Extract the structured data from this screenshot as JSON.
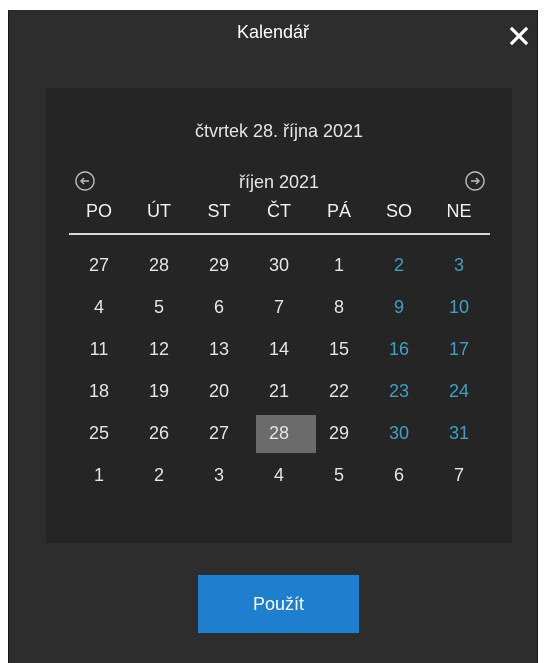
{
  "window": {
    "title": "Kalendář"
  },
  "calendar": {
    "selected_long_date": "čtvrtek 28. října 2021",
    "month_label": "říjen 2021",
    "weekdays": [
      "PO",
      "ÚT",
      "ST",
      "ČT",
      "PÁ",
      "SO",
      "NE"
    ],
    "days": [
      {
        "label": "27",
        "weekend": false,
        "selected": false
      },
      {
        "label": "28",
        "weekend": false,
        "selected": false
      },
      {
        "label": "29",
        "weekend": false,
        "selected": false
      },
      {
        "label": "30",
        "weekend": false,
        "selected": false
      },
      {
        "label": "1",
        "weekend": false,
        "selected": false
      },
      {
        "label": "2",
        "weekend": true,
        "selected": false
      },
      {
        "label": "3",
        "weekend": true,
        "selected": false
      },
      {
        "label": "4",
        "weekend": false,
        "selected": false
      },
      {
        "label": "5",
        "weekend": false,
        "selected": false
      },
      {
        "label": "6",
        "weekend": false,
        "selected": false
      },
      {
        "label": "7",
        "weekend": false,
        "selected": false
      },
      {
        "label": "8",
        "weekend": false,
        "selected": false
      },
      {
        "label": "9",
        "weekend": true,
        "selected": false
      },
      {
        "label": "10",
        "weekend": true,
        "selected": false
      },
      {
        "label": "11",
        "weekend": false,
        "selected": false
      },
      {
        "label": "12",
        "weekend": false,
        "selected": false
      },
      {
        "label": "13",
        "weekend": false,
        "selected": false
      },
      {
        "label": "14",
        "weekend": false,
        "selected": false
      },
      {
        "label": "15",
        "weekend": false,
        "selected": false
      },
      {
        "label": "16",
        "weekend": true,
        "selected": false
      },
      {
        "label": "17",
        "weekend": true,
        "selected": false
      },
      {
        "label": "18",
        "weekend": false,
        "selected": false
      },
      {
        "label": "19",
        "weekend": false,
        "selected": false
      },
      {
        "label": "20",
        "weekend": false,
        "selected": false
      },
      {
        "label": "21",
        "weekend": false,
        "selected": false
      },
      {
        "label": "22",
        "weekend": false,
        "selected": false
      },
      {
        "label": "23",
        "weekend": true,
        "selected": false
      },
      {
        "label": "24",
        "weekend": true,
        "selected": false
      },
      {
        "label": "25",
        "weekend": false,
        "selected": false
      },
      {
        "label": "26",
        "weekend": false,
        "selected": false
      },
      {
        "label": "27",
        "weekend": false,
        "selected": false
      },
      {
        "label": "28",
        "weekend": false,
        "selected": true
      },
      {
        "label": "29",
        "weekend": false,
        "selected": false
      },
      {
        "label": "30",
        "weekend": true,
        "selected": false
      },
      {
        "label": "31",
        "weekend": true,
        "selected": false
      },
      {
        "label": "1",
        "weekend": false,
        "selected": false
      },
      {
        "label": "2",
        "weekend": false,
        "selected": false
      },
      {
        "label": "3",
        "weekend": false,
        "selected": false
      },
      {
        "label": "4",
        "weekend": false,
        "selected": false
      },
      {
        "label": "5",
        "weekend": false,
        "selected": false
      },
      {
        "label": "6",
        "weekend": false,
        "selected": false
      },
      {
        "label": "7",
        "weekend": false,
        "selected": false
      }
    ]
  },
  "actions": {
    "apply_label": "Použít"
  },
  "icons": {
    "close": "close-icon",
    "prev": "arrow-left-circle-icon",
    "next": "arrow-right-circle-icon"
  },
  "colors": {
    "window_bg": "#2d2d2d",
    "panel_bg": "#252525",
    "weekend_text": "#3fa1c2",
    "selected_bg": "#6b6b6b",
    "accent_button": "#1e7fcf"
  }
}
